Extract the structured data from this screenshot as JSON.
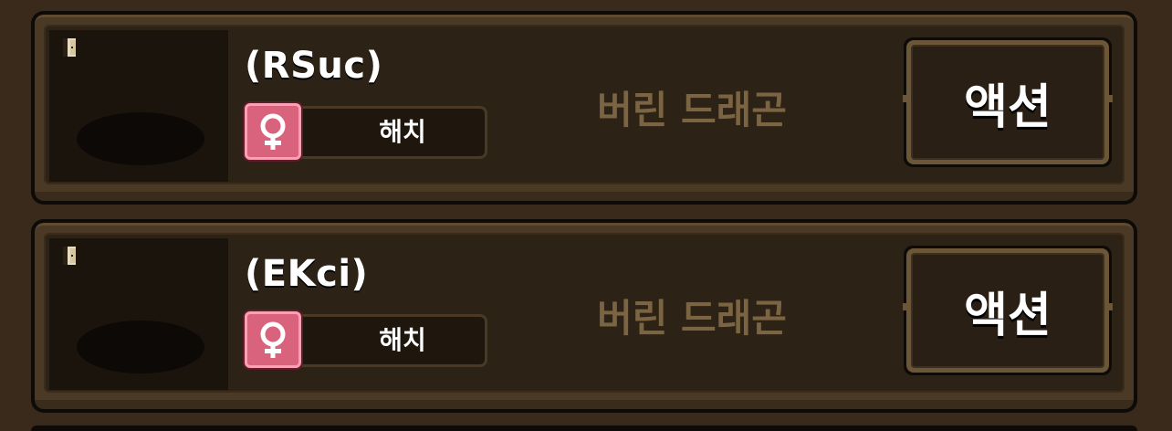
{
  "dragons": [
    {
      "name": "(RSuc)",
      "gender": "female",
      "gender_icon": "female-symbol-icon",
      "status": "해치",
      "type": "버린 드래곤",
      "action_label": "액션"
    },
    {
      "name": "(EKci)",
      "gender": "female",
      "gender_icon": "female-symbol-icon",
      "status": "해치",
      "type": "버린 드래곤",
      "action_label": "액션"
    }
  ],
  "colors": {
    "background": "#3a2a1c",
    "card": "#2d2216",
    "female_badge": "#d9637d",
    "type_text": "#7a6442",
    "button_frame": "#6b5637"
  }
}
